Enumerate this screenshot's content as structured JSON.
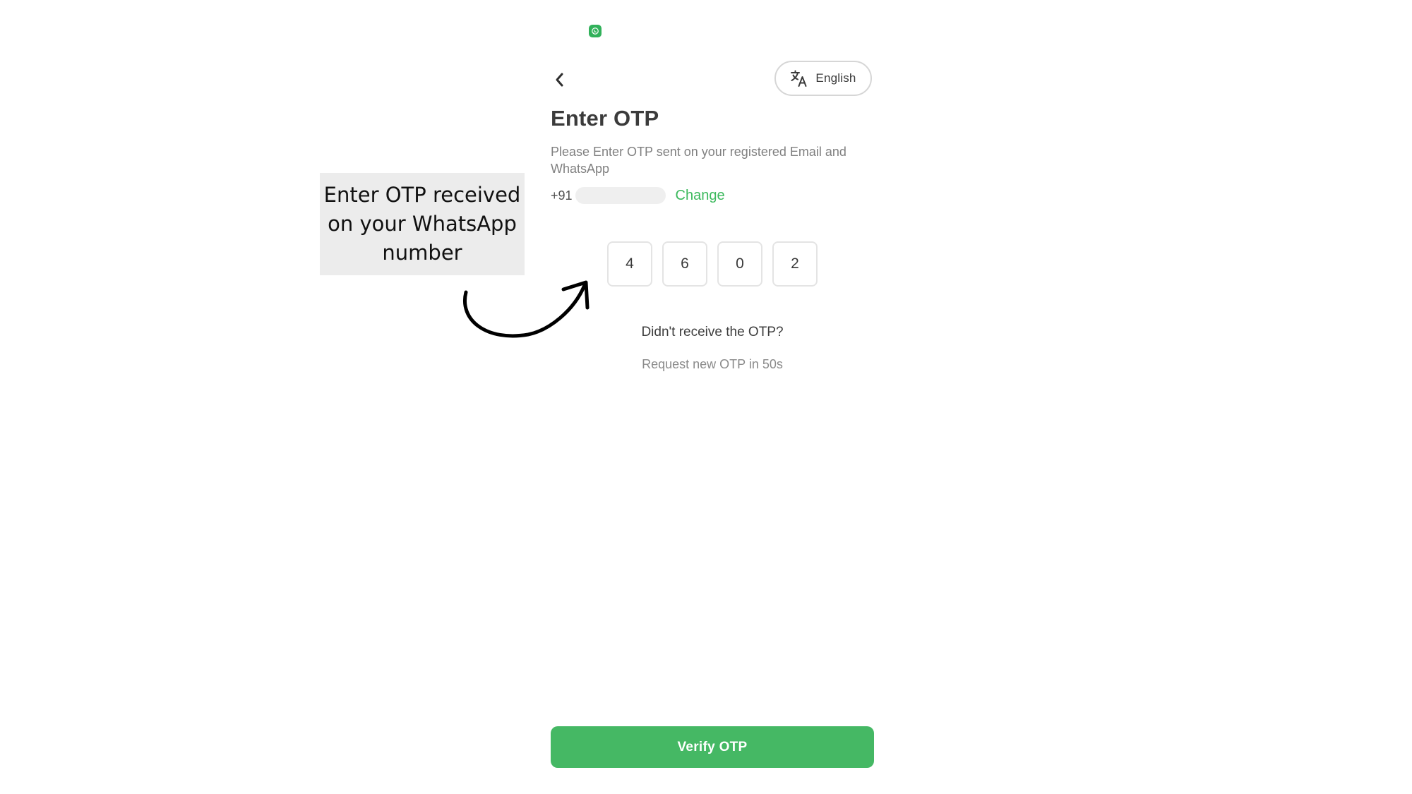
{
  "status_bar": {
    "app_icon": "whatsapp-icon"
  },
  "header": {
    "back_icon": "chevron-left-icon",
    "language": {
      "icon": "translate-icon",
      "label": "English"
    }
  },
  "main": {
    "title": "Enter OTP",
    "subtitle": "Please Enter OTP sent on your registered Email and WhatsApp",
    "phone_prefix": "+91",
    "change_label": "Change",
    "otp_digits": [
      "4",
      "6",
      "0",
      "2"
    ],
    "didnt_receive": "Didn't receive the OTP?",
    "resend_timer": "Request new OTP in 50s"
  },
  "footer": {
    "verify_label": "Verify OTP"
  },
  "annotation": {
    "text": "Enter OTP received on your WhatsApp number",
    "arrow_icon": "curved-arrow-icon"
  },
  "colors": {
    "accent": "#45b864",
    "link": "#3cb95d",
    "whatsapp": "#31b15a",
    "callout_bg": "#ececec"
  }
}
